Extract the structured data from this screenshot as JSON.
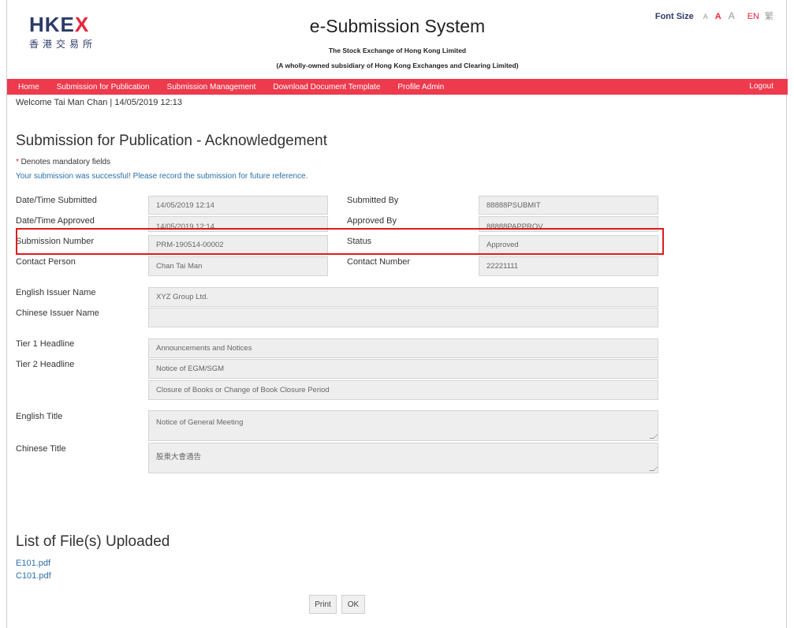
{
  "header": {
    "logo_main_a": "HKE",
    "logo_main_x": "X",
    "logo_sub": "香港交易所",
    "site_title": "e-Submission System",
    "subtitle1": "The Stock Exchange of Hong Kong Limited",
    "subtitle2": "(A wholly-owned subsidiary of Hong Kong Exchanges and Clearing Limited)",
    "font_size_label": "Font Size",
    "font_small": "A",
    "font_medium": "A",
    "font_large": "A",
    "lang_en": "EN",
    "lang_tc": "繁"
  },
  "nav": {
    "items": [
      "Home",
      "Submission for Publication",
      "Submission Management",
      "Download Document Template",
      "Profile Admin"
    ],
    "logout": "Logout"
  },
  "welcome": "Welcome Tai Man Chan | 14/05/2019 12:13",
  "page_title": "Submission for Publication - Acknowledgement",
  "mandatory_star": "*",
  "mandatory_text": " Denotes mandatory fields",
  "success_message": "Your submission was successful! Please record the submission for future reference.",
  "form": {
    "datetime_submitted_label": "Date/Time Submitted",
    "datetime_submitted_value": "14/05/2019 12:14",
    "submitted_by_label": "Submitted By",
    "submitted_by_value": "88888PSUBMIT",
    "datetime_approved_label": "Date/Time Approved",
    "datetime_approved_value": "14/05/2019 12:14",
    "approved_by_label": "Approved By",
    "approved_by_value": "88888PAPPROV",
    "submission_number_label": "Submission Number",
    "submission_number_value": "PRM-190514-00002",
    "status_label": "Status",
    "status_value": "Approved",
    "contact_person_label": "Contact Person",
    "contact_person_value": "Chan Tai Man",
    "contact_number_label": "Contact Number",
    "contact_number_value": "22221111",
    "english_issuer_label": "English Issuer Name",
    "english_issuer_value": "XYZ Group Ltd.",
    "chinese_issuer_label": "Chinese Issuer Name",
    "chinese_issuer_value": "",
    "tier1_label": "Tier 1 Headline",
    "tier1_value": "Announcements and Notices",
    "tier2_label": "Tier 2 Headline",
    "tier2_value_1": "Notice of EGM/SGM",
    "tier2_value_2": "Closure of Books or Change of Book Closure Period",
    "english_title_label": "English Title",
    "english_title_value": "Notice of General Meeting",
    "chinese_title_label": "Chinese Title",
    "chinese_title_value": "股東大會通告"
  },
  "files": {
    "title": "List of File(s) Uploaded",
    "items": [
      "E101.pdf",
      "C101.pdf"
    ]
  },
  "buttons": {
    "print": "Print",
    "ok": "OK"
  },
  "colors": {
    "brand_red": "#ed3a4d",
    "brand_navy": "#2b3a67",
    "link_blue": "#2a6fa8",
    "highlight_red": "#e01a1a"
  }
}
